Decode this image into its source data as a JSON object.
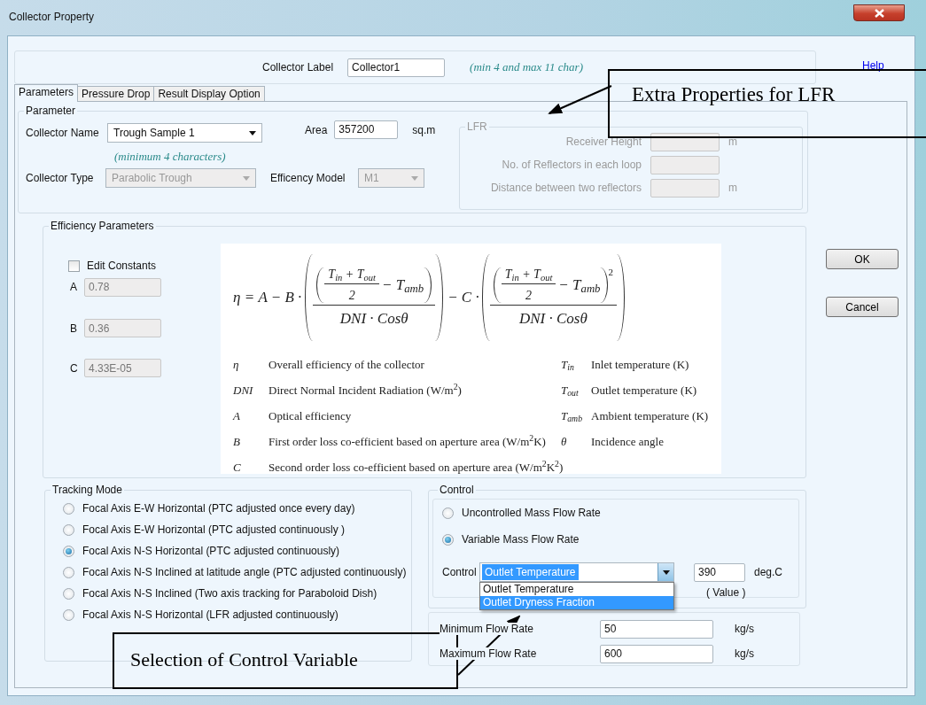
{
  "window": {
    "title": "Collector Property"
  },
  "collector_label": {
    "label": "Collector Label",
    "value": "Collector1",
    "hint": "(min 4 and max 11 char)"
  },
  "help_link": "Help",
  "tabs": [
    {
      "label": "Parameters",
      "selected": true
    },
    {
      "label": "Pressure Drop",
      "selected": false
    },
    {
      "label": "Result Display Option",
      "selected": false
    }
  ],
  "parameter": {
    "title": "Parameter",
    "collector_name": {
      "label": "Collector Name",
      "value": "Trough Sample 1",
      "hint": "(minimum 4 characters)"
    },
    "area": {
      "label": "Area",
      "value": "357200",
      "unit": "sq.m"
    },
    "collector_type": {
      "label": "Collector Type",
      "value": "Parabolic Trough",
      "disabled": true
    },
    "efficiency_model": {
      "label": "Efficency Model",
      "value": "M1",
      "disabled": true
    }
  },
  "lfr": {
    "title": "LFR",
    "disabled": true,
    "fields": [
      {
        "label": "Receiver Height",
        "unit": "m"
      },
      {
        "label": "No. of Reflectors in each loop"
      },
      {
        "label": "Distance between two reflectors",
        "unit": "m"
      }
    ]
  },
  "efficiency": {
    "title": "Efficiency Parameters",
    "edit_constants": {
      "label": "Edit Constants",
      "checked": false
    },
    "constants": [
      {
        "label": "A",
        "value": "0.78",
        "disabled": true
      },
      {
        "label": "B",
        "value": "0.36",
        "disabled": true
      },
      {
        "label": "C",
        "value": "4.33E-05",
        "disabled": true
      }
    ],
    "formula": {
      "lhs": "η = A − B ·",
      "terms": [
        {
          "inner_num": "T$_{in}$ + T$_{out}$",
          "inner_den": "2",
          "rest": "− T$_{amb}$",
          "den": "DNI · Cosθ"
        },
        {
          "prefix": "− C ·",
          "inner_num": "T$_{in}$ + T$_{out}$",
          "inner_den": "2",
          "rest": "− T$_{amb}$",
          "power": "2",
          "den": "DNI · Cosθ"
        }
      ]
    },
    "legend_rows": [
      {
        "left": {
          "symbol": "η",
          "text": "Overall efficiency of the collector"
        },
        "right": {
          "symbol": "T$_{in}$",
          "text": "Inlet temperature (K)"
        }
      },
      {
        "left": {
          "symbol": "DNI",
          "text": "Direct Normal Incident Radiation (W/m$^{2}$)"
        },
        "right": {
          "symbol": "T$_{out}$",
          "text": "Outlet temperature (K)"
        }
      },
      {
        "left": {
          "symbol": "A",
          "text": "Optical efficiency"
        },
        "right": {
          "symbol": "T$_{amb}$",
          "text": "Ambient temperature (K)"
        }
      },
      {
        "left": {
          "symbol": "B",
          "text": "First order loss co-efficient based on aperture area (W/m$^{2}$K)"
        },
        "right": {
          "symbol": "θ",
          "text": "Incidence angle"
        }
      },
      {
        "left": {
          "symbol": "C",
          "text": "Second order loss co-efficient based on aperture area (W/m$^{2}$K$^{2}$)"
        }
      }
    ]
  },
  "tracking": {
    "title": "Tracking Mode",
    "options": [
      {
        "label": "Focal Axis E-W Horizontal  (PTC  adjusted once every day)",
        "selected": false
      },
      {
        "label": "Focal Axis E-W Horizontal (PTC adjusted continuously )",
        "selected": false
      },
      {
        "label": "Focal Axis N-S Horizontal (PTC adjusted continuously)",
        "selected": true
      },
      {
        "label": "Focal Axis N-S Inclined at latitude angle (PTC adjusted continuously)",
        "selected": false
      },
      {
        "label": "Focal Axis N-S Inclined (Two axis tracking for Paraboloid Dish)",
        "selected": false
      },
      {
        "label": "Focal Axis N-S Horizontal (LFR adjusted continuously)",
        "selected": false
      }
    ]
  },
  "control": {
    "title": "Control",
    "modes": [
      {
        "label": "Uncontrolled Mass Flow Rate",
        "selected": false
      },
      {
        "label": "Variable Mass Flow Rate",
        "selected": true
      }
    ],
    "variable": {
      "label": "Control",
      "value": "Outlet Temperature",
      "expanded": true,
      "options": [
        {
          "label": "Outlet Temperature",
          "highlighted": false
        },
        {
          "label": "Outlet Dryness Fraction",
          "highlighted": true
        }
      ],
      "setpoint": "390",
      "unit": "deg.C",
      "caption": "( Value )"
    },
    "flow_rates": [
      {
        "label": "Minimum Flow Rate",
        "value": "50",
        "unit": "kg/s"
      },
      {
        "label": "Maximum Flow Rate",
        "value": "600",
        "unit": "kg/s"
      }
    ]
  },
  "buttons": [
    "OK",
    "Cancel"
  ],
  "annotations": [
    {
      "text": "Extra Properties for LFR"
    },
    {
      "text": "Selection of Control Variable"
    }
  ]
}
